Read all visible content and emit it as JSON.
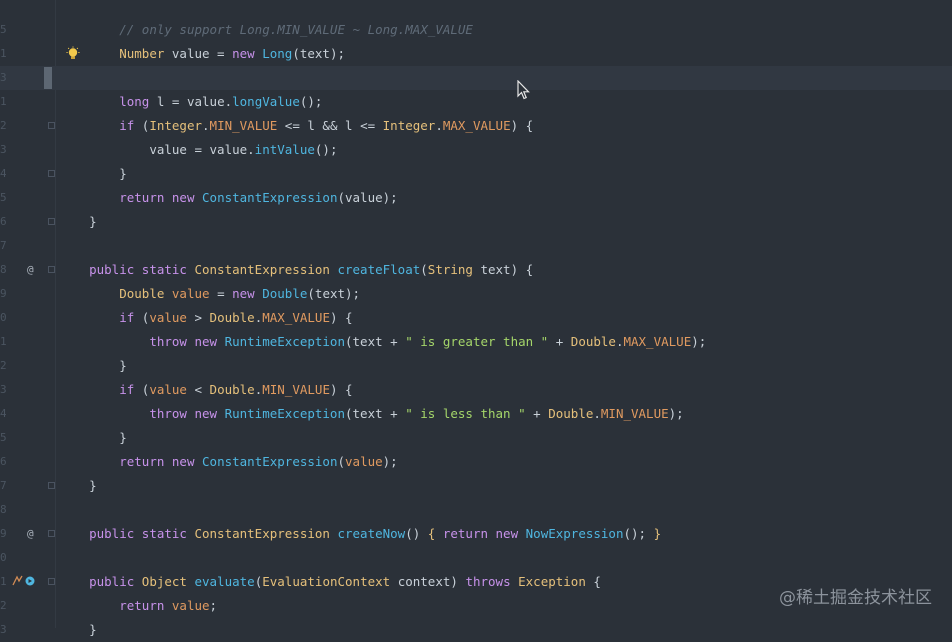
{
  "editor": {
    "line_numbers": [
      "5",
      "1",
      "3",
      "1",
      "2",
      "3",
      "4",
      "5",
      "6",
      "7",
      "8",
      "9",
      "0",
      "1",
      "2",
      "3",
      "4",
      "5",
      "6",
      "7",
      "8",
      "9",
      "0",
      "1",
      "2",
      "3"
    ],
    "lines": [
      {
        "indent": "        ",
        "tokens": [
          [
            "cmt",
            "// only support Long.MIN_VALUE ~ Long.MAX_VALUE"
          ]
        ]
      },
      {
        "indent": "        ",
        "tokens": [
          [
            "type",
            "Number"
          ],
          [
            "plain",
            " value = "
          ],
          [
            "kw",
            "new "
          ],
          [
            "fn",
            "Long"
          ],
          [
            "plain",
            "(text);"
          ]
        ]
      },
      {
        "indent": "",
        "tokens": []
      },
      {
        "indent": "        ",
        "tokens": [
          [
            "kw",
            "long "
          ],
          [
            "plain",
            "l = value."
          ],
          [
            "fn",
            "longValue"
          ],
          [
            "plain",
            "();"
          ]
        ]
      },
      {
        "indent": "        ",
        "tokens": [
          [
            "kw",
            "if "
          ],
          [
            "plain",
            "("
          ],
          [
            "type",
            "Integer"
          ],
          [
            "plain",
            "."
          ],
          [
            "field",
            "MIN_VALUE"
          ],
          [
            "plain",
            " <= l && l <= "
          ],
          [
            "type",
            "Integer"
          ],
          [
            "plain",
            "."
          ],
          [
            "field",
            "MAX_VALUE"
          ],
          [
            "plain",
            ") {"
          ]
        ]
      },
      {
        "indent": "            ",
        "tokens": [
          [
            "plain",
            "value = value."
          ],
          [
            "fn",
            "intValue"
          ],
          [
            "plain",
            "();"
          ]
        ]
      },
      {
        "indent": "        ",
        "tokens": [
          [
            "plain",
            "}"
          ]
        ]
      },
      {
        "indent": "        ",
        "tokens": [
          [
            "kw",
            "return new "
          ],
          [
            "fn",
            "ConstantExpression"
          ],
          [
            "plain",
            "(value);"
          ]
        ]
      },
      {
        "indent": "    ",
        "tokens": [
          [
            "plain",
            "}"
          ]
        ]
      },
      {
        "indent": "",
        "tokens": []
      },
      {
        "indent": "    ",
        "tokens": [
          [
            "kw",
            "public static "
          ],
          [
            "type",
            "ConstantExpression "
          ],
          [
            "fn",
            "createFloat"
          ],
          [
            "plain",
            "("
          ],
          [
            "type",
            "String"
          ],
          [
            "plain",
            " text) {"
          ]
        ]
      },
      {
        "indent": "        ",
        "tokens": [
          [
            "type",
            "Double"
          ],
          [
            "plain",
            " "
          ],
          [
            "field",
            "value"
          ],
          [
            "plain",
            " = "
          ],
          [
            "kw",
            "new "
          ],
          [
            "fn",
            "Double"
          ],
          [
            "plain",
            "(text);"
          ]
        ]
      },
      {
        "indent": "        ",
        "tokens": [
          [
            "kw",
            "if "
          ],
          [
            "plain",
            "("
          ],
          [
            "field",
            "value"
          ],
          [
            "plain",
            " > "
          ],
          [
            "type",
            "Double"
          ],
          [
            "plain",
            "."
          ],
          [
            "field",
            "MAX_VALUE"
          ],
          [
            "plain",
            ") {"
          ]
        ]
      },
      {
        "indent": "            ",
        "tokens": [
          [
            "kw",
            "throw new "
          ],
          [
            "fn",
            "RuntimeException"
          ],
          [
            "plain",
            "(text + "
          ],
          [
            "str",
            "\" is greater than \""
          ],
          [
            "plain",
            " + "
          ],
          [
            "type",
            "Double"
          ],
          [
            "plain",
            "."
          ],
          [
            "field",
            "MAX_VALUE"
          ],
          [
            "plain",
            ");"
          ]
        ]
      },
      {
        "indent": "        ",
        "tokens": [
          [
            "plain",
            "}"
          ]
        ]
      },
      {
        "indent": "        ",
        "tokens": [
          [
            "kw",
            "if "
          ],
          [
            "plain",
            "("
          ],
          [
            "field",
            "value"
          ],
          [
            "plain",
            " < "
          ],
          [
            "type",
            "Double"
          ],
          [
            "plain",
            "."
          ],
          [
            "field",
            "MIN_VALUE"
          ],
          [
            "plain",
            ") {"
          ]
        ]
      },
      {
        "indent": "            ",
        "tokens": [
          [
            "kw",
            "throw new "
          ],
          [
            "fn",
            "RuntimeException"
          ],
          [
            "plain",
            "(text + "
          ],
          [
            "str",
            "\" is less than \""
          ],
          [
            "plain",
            " + "
          ],
          [
            "type",
            "Double"
          ],
          [
            "plain",
            "."
          ],
          [
            "field",
            "MIN_VALUE"
          ],
          [
            "plain",
            ");"
          ]
        ]
      },
      {
        "indent": "        ",
        "tokens": [
          [
            "plain",
            "}"
          ]
        ]
      },
      {
        "indent": "        ",
        "tokens": [
          [
            "kw",
            "return new "
          ],
          [
            "fn",
            "ConstantExpression"
          ],
          [
            "plain",
            "("
          ],
          [
            "field",
            "value"
          ],
          [
            "plain",
            ");"
          ]
        ]
      },
      {
        "indent": "    ",
        "tokens": [
          [
            "plain",
            "}"
          ]
        ]
      },
      {
        "indent": "",
        "tokens": []
      },
      {
        "indent": "    ",
        "tokens": [
          [
            "kw",
            "public static "
          ],
          [
            "type",
            "ConstantExpression "
          ],
          [
            "fn",
            "createNow"
          ],
          [
            "plain",
            "() "
          ],
          [
            "type",
            "{ "
          ],
          [
            "kw",
            "return new "
          ],
          [
            "fn",
            "NowExpression"
          ],
          [
            "plain",
            "(); "
          ],
          [
            "type",
            "}"
          ]
        ]
      },
      {
        "indent": "",
        "tokens": []
      },
      {
        "indent": "    ",
        "tokens": [
          [
            "kw",
            "public "
          ],
          [
            "type",
            "Object "
          ],
          [
            "fn",
            "evaluate"
          ],
          [
            "plain",
            "("
          ],
          [
            "type",
            "EvaluationContext"
          ],
          [
            "plain",
            " context) "
          ],
          [
            "kw",
            "throws "
          ],
          [
            "type",
            "Exception"
          ],
          [
            "plain",
            " {"
          ]
        ]
      },
      {
        "indent": "        ",
        "tokens": [
          [
            "kw",
            "return "
          ],
          [
            "field",
            "value"
          ],
          [
            "plain",
            ";"
          ]
        ]
      },
      {
        "indent": "    ",
        "tokens": [
          [
            "plain",
            "}"
          ]
        ]
      }
    ],
    "gutter_markers": {
      "10": "@",
      "21": "@"
    }
  },
  "watermark": "@稀土掘金技术社区",
  "colors": {
    "background": "#2b3139",
    "keyword": "#c792ea",
    "type": "#e5c07b",
    "function": "#4fb6e0",
    "field": "#e09a60",
    "string": "#a5d66a",
    "comment": "#5f6b78"
  },
  "icons": {
    "intention": "lightbulb-icon",
    "override": "at-override-icon",
    "run": "run-gutter-icon",
    "pointer": "mouse-pointer-icon"
  }
}
